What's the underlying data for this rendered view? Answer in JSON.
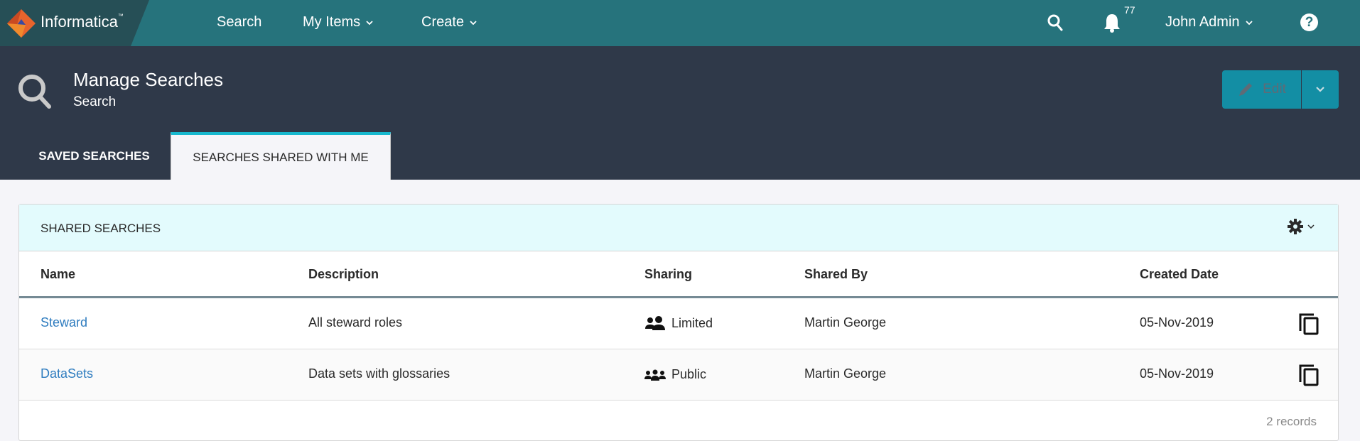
{
  "nav": {
    "brand": "Informatica",
    "items": [
      {
        "label": "Search",
        "has_dropdown": false
      },
      {
        "label": "My Items",
        "has_dropdown": true
      },
      {
        "label": "Create",
        "has_dropdown": true
      }
    ],
    "notification_count": "77",
    "user": "John Admin",
    "help": "?"
  },
  "header": {
    "title": "Manage Searches",
    "subtitle": "Search",
    "edit_label": "Edit"
  },
  "tabs": [
    {
      "label": "SAVED SEARCHES",
      "active": false
    },
    {
      "label": "SEARCHES SHARED WITH ME",
      "active": true
    }
  ],
  "panel": {
    "title": "SHARED SEARCHES",
    "columns": [
      "Name",
      "Description",
      "Sharing",
      "Shared By",
      "Created Date"
    ],
    "rows": [
      {
        "name": "Steward",
        "description": "All steward roles",
        "sharing": "Limited",
        "sharing_icon": "users-icon",
        "shared_by": "Martin George",
        "created": "05-Nov-2019"
      },
      {
        "name": "DataSets",
        "description": "Data sets with glossaries",
        "sharing": "Public",
        "sharing_icon": "group-icon",
        "shared_by": "Martin George",
        "created": "05-Nov-2019"
      }
    ],
    "record_count": "2 records"
  },
  "colors": {
    "nav": "#26737c",
    "header": "#2f3949",
    "accent": "#17b8ce",
    "link": "#2e7cbf",
    "button": "#138ea4"
  }
}
